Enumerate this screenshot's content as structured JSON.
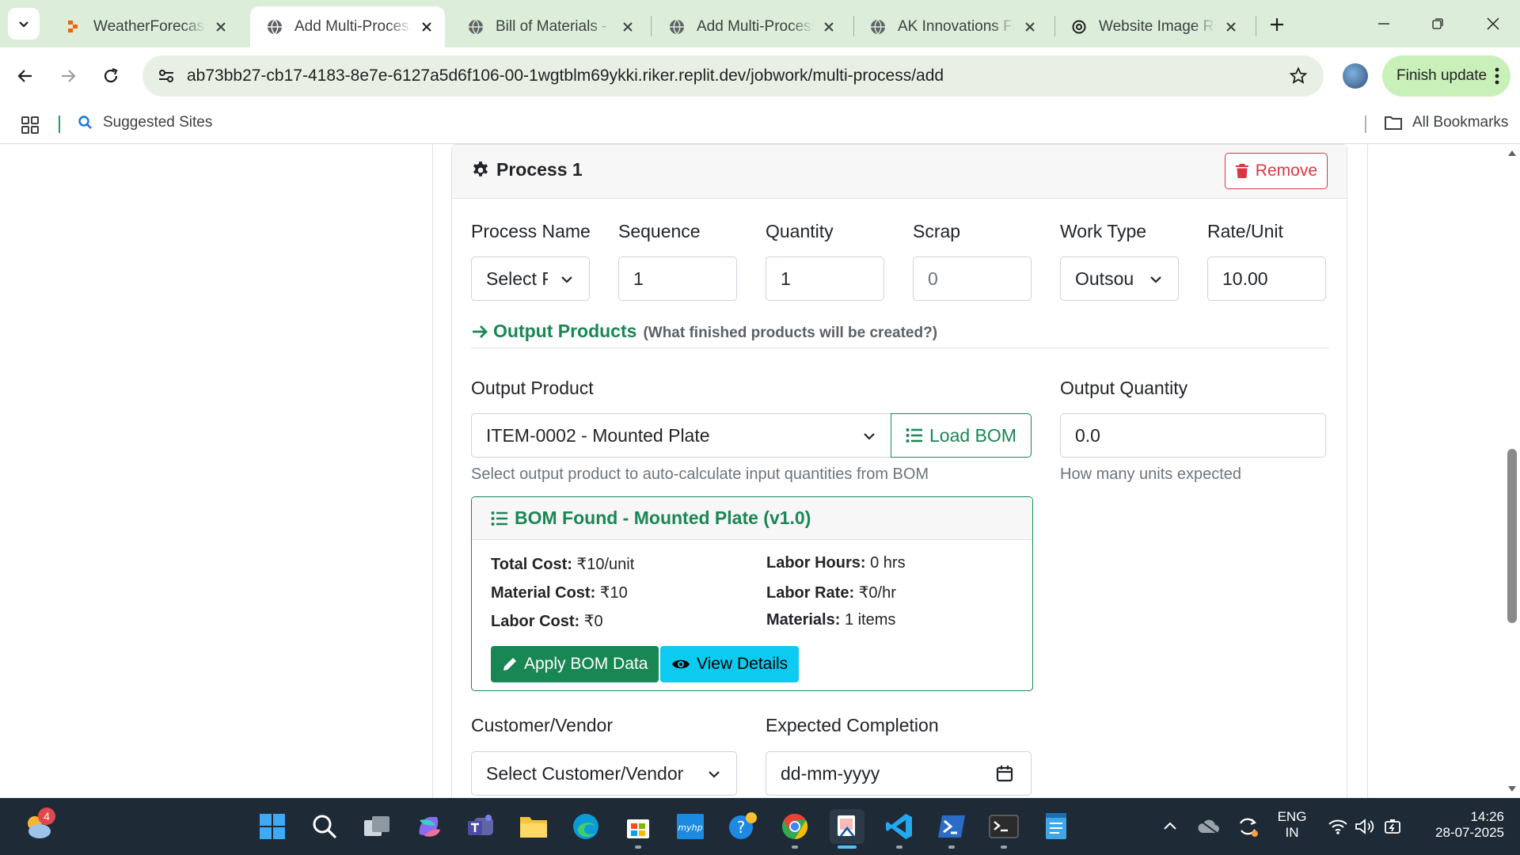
{
  "browser": {
    "tabs": [
      {
        "title": "WeatherForecast -",
        "icon": "replit-icon"
      },
      {
        "title": "Add Multi-Process",
        "icon": "globe-icon",
        "active": true
      },
      {
        "title": "Bill of Materials - F",
        "icon": "globe-icon"
      },
      {
        "title": "Add Multi-Process",
        "icon": "globe-icon"
      },
      {
        "title": "AK Innovations Fac",
        "icon": "globe-icon"
      },
      {
        "title": "Website Image Rec",
        "icon": "openai-icon"
      }
    ],
    "url": "ab73bb27-cb17-4183-8e7e-6127a5d6f106-00-1wgtblm69ykki.riker.replit.dev/jobwork/multi-process/add",
    "finish_update": "Finish update",
    "bookmarks": {
      "suggested": "Suggested Sites",
      "all": "All Bookmarks"
    }
  },
  "process": {
    "title": "Process 1",
    "remove_label": "Remove",
    "labels": {
      "process_name": "Process Name",
      "sequence": "Sequence",
      "quantity": "Quantity",
      "scrap": "Scrap",
      "work_type": "Work Type",
      "rate_unit": "Rate/Unit"
    },
    "values": {
      "process_name": "Select P",
      "sequence": "1",
      "quantity": "1",
      "scrap": "0",
      "work_type": "Outsou",
      "rate_unit": "10.00"
    },
    "output_section": {
      "title": "Output Products",
      "subtitle": "(What finished products will be created?)"
    },
    "output_product_label": "Output Product",
    "output_product_value": "ITEM-0002 - Mounted Plate",
    "load_bom_label": "Load BOM",
    "output_product_help": "Select output product to auto-calculate input quantities from BOM",
    "output_quantity_label": "Output Quantity",
    "output_quantity_value": "0.0",
    "output_quantity_help": "How many units expected",
    "bom": {
      "title": "BOM Found - Mounted Plate (v1.0)",
      "total_cost_k": "Total Cost:",
      "total_cost_v": "₹10/unit",
      "material_cost_k": "Material Cost:",
      "material_cost_v": "₹10",
      "labor_cost_k": "Labor Cost:",
      "labor_cost_v": "₹0",
      "labor_hours_k": "Labor Hours:",
      "labor_hours_v": "0 hrs",
      "labor_rate_k": "Labor Rate:",
      "labor_rate_v": "₹0/hr",
      "materials_k": "Materials:",
      "materials_v": "1 items",
      "apply_label": "Apply BOM Data",
      "view_label": "View Details"
    },
    "customer_label": "Customer/Vendor",
    "customer_value": "Select Customer/Vendor",
    "completion_label": "Expected Completion",
    "completion_placeholder": "dd-mm-yyyy"
  },
  "taskbar": {
    "weather_badge": "4",
    "lang_top": "ENG",
    "lang_bottom": "IN",
    "time": "14:26",
    "date": "28-07-2025"
  },
  "colors": {
    "success": "#198754",
    "danger": "#dc3545",
    "info": "#0dcaf0",
    "tabstrip": "#dceeda"
  }
}
